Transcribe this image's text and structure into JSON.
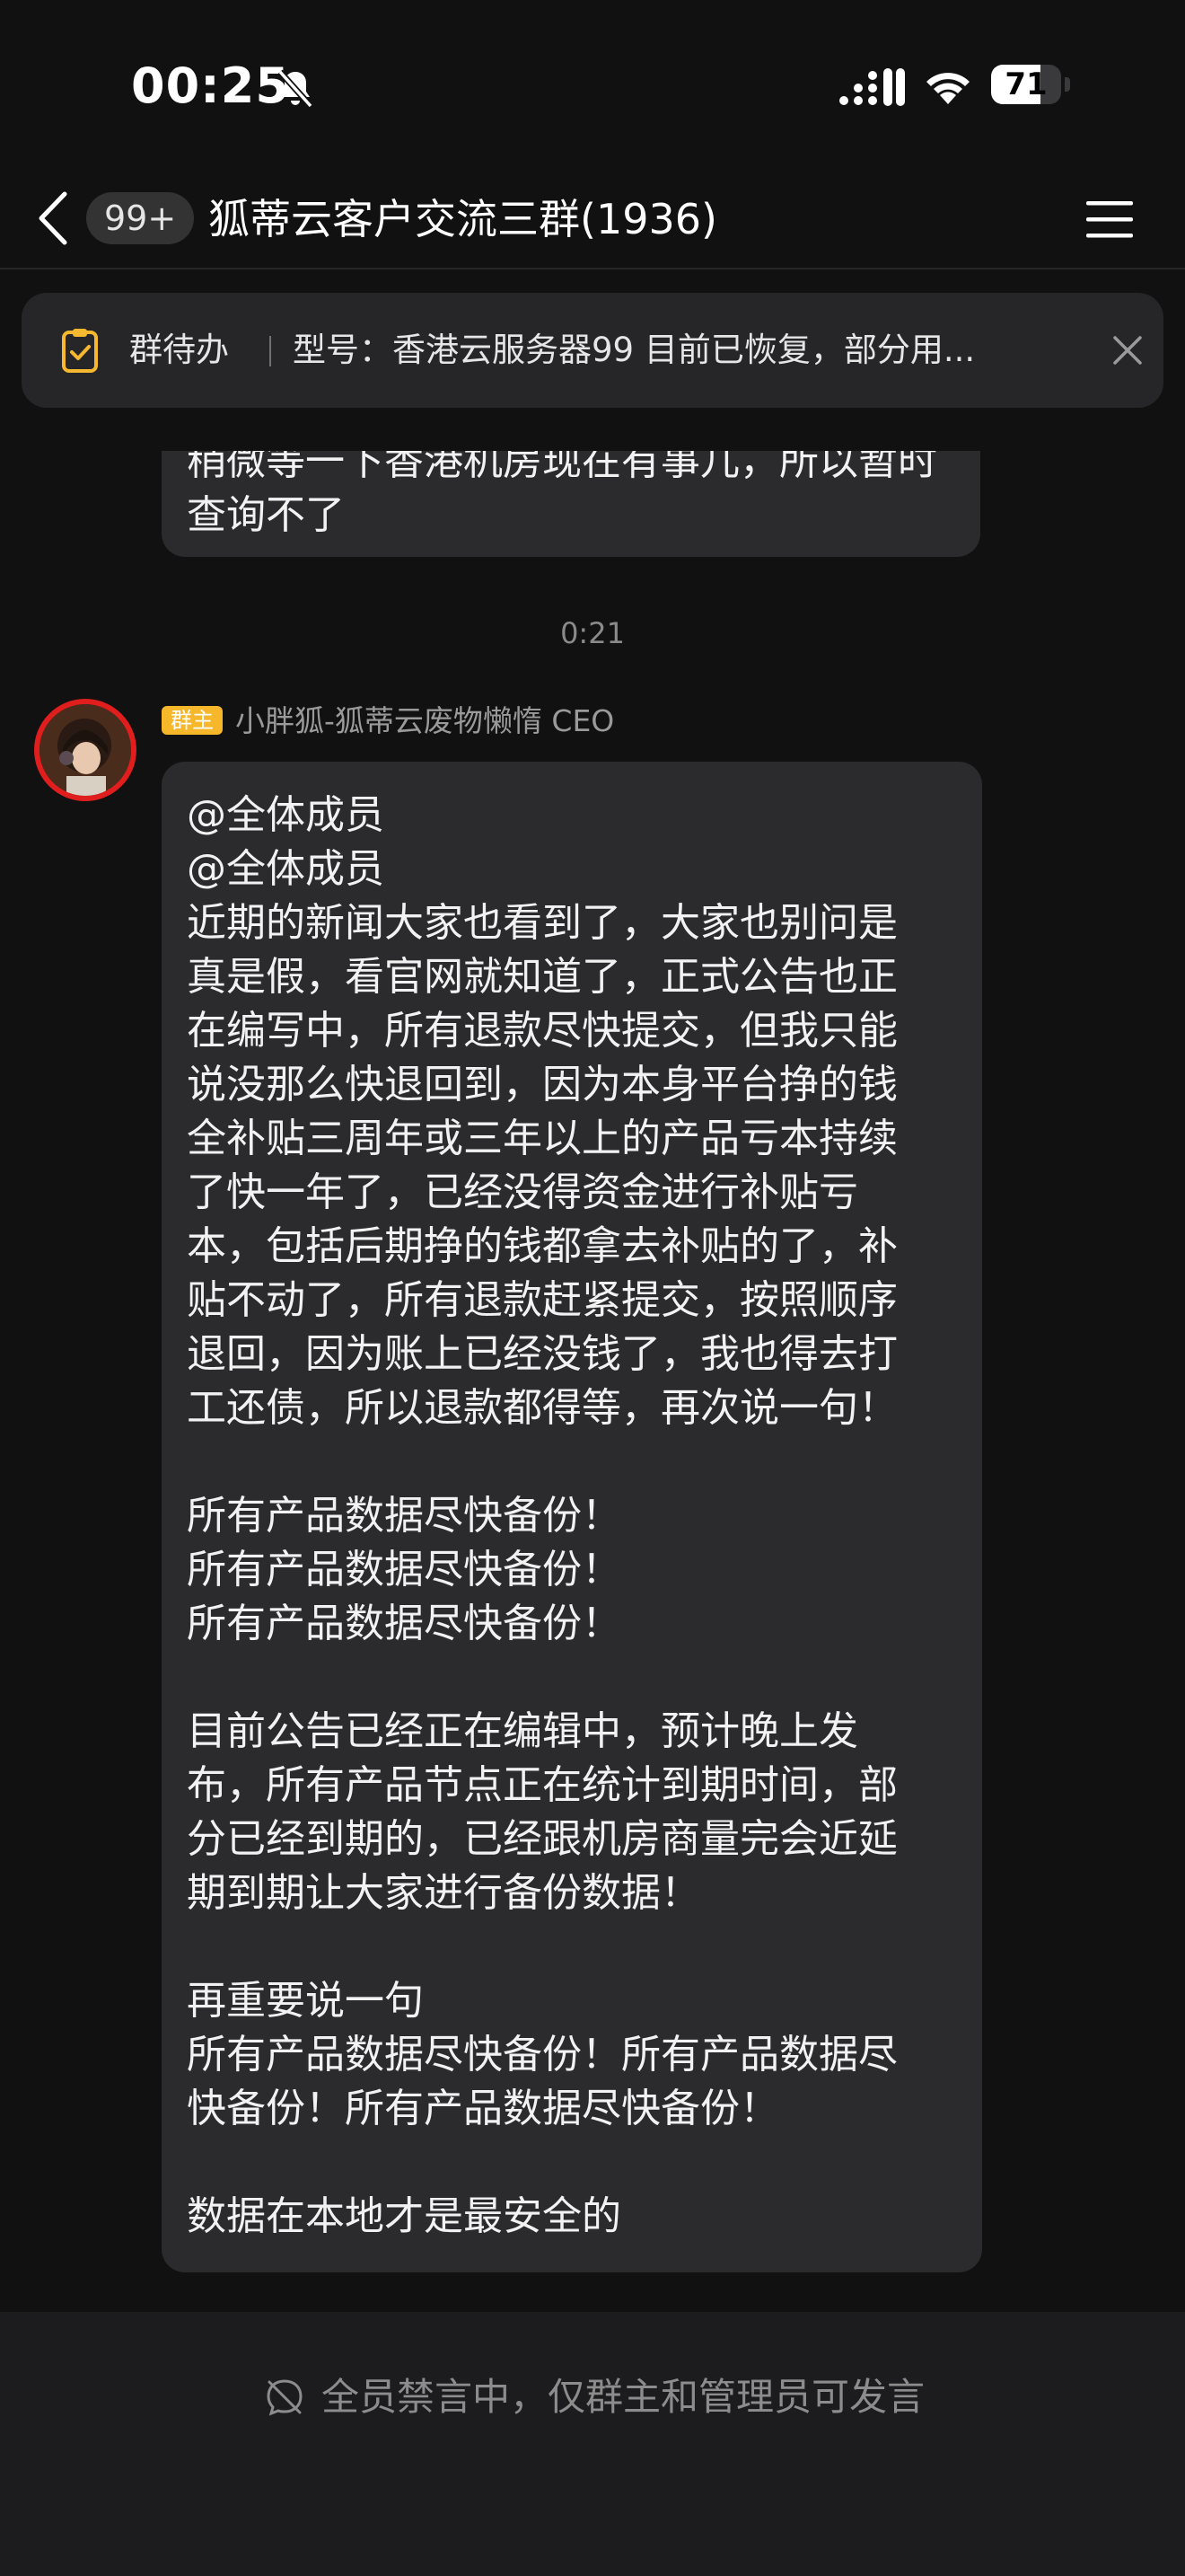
{
  "status_bar": {
    "time": "00:25",
    "battery_level": "71",
    "battery_fraction": 0.71,
    "icons": [
      "bell-muted-icon",
      "signal-icon",
      "wifi-icon",
      "battery-icon"
    ]
  },
  "nav": {
    "unread_badge": "99+",
    "title": "狐蒂云客户交流三群(1936)",
    "icons": [
      "back-icon",
      "menu-icon"
    ]
  },
  "pinned_todo": {
    "label": "群待办",
    "text": "型号：香港云服务器99 目前已恢复，部分用...",
    "icons": [
      "todo-icon",
      "close-icon"
    ]
  },
  "messages": [
    {
      "partial": true,
      "lines": [
        "稍微等一下香港机房现在有事儿，所以暂时",
        "查询不了"
      ]
    }
  ],
  "timestamp": "0:21",
  "announcement": {
    "owner_badge": "群主",
    "sender": "小胖狐-狐蒂云废物懒惰 CEO",
    "lines": [
      "@全体成员",
      "@全体成员",
      "近期的新闻大家也看到了，大家也别问是",
      "真是假，看官网就知道了，正式公告也正",
      "在编写中，所有退款尽快提交，但我只能",
      "说没那么快退回到，因为本身平台挣的钱",
      "全补贴三周年或三年以上的产品亏本持续",
      "了快一年了，已经没得资金进行补贴亏",
      "本，包括后期挣的钱都拿去补贴的了，补",
      "贴不动了，所有退款赶紧提交，按照顺序",
      "退回，因为账上已经没钱了，我也得去打",
      "工还债，所以退款都得等，再次说一句！",
      "",
      "所有产品数据尽快备份！",
      "所有产品数据尽快备份！",
      "所有产品数据尽快备份！",
      "",
      "目前公告已经正在编辑中，预计晚上发",
      "布，所有产品节点正在统计到期时间，部",
      "分已经到期的，已经跟机房商量完会近延",
      "期到期让大家进行备份数据！",
      "",
      "再重要说一句",
      "所有产品数据尽快备份！所有产品数据尽",
      "快备份！所有产品数据尽快备份！",
      "",
      "数据在本地才是最安全的"
    ]
  },
  "bottom_bar": {
    "mute_notice": "全员禁言中，仅群主和管理员可发言",
    "icon": "no-speaking-icon"
  },
  "colors": {
    "background": "#111111",
    "bubble": "#2b2b2d",
    "owner_badge": "#f6b72b",
    "todo_icon": "#f5b82e",
    "avatar_ring": "#e01e1e"
  }
}
